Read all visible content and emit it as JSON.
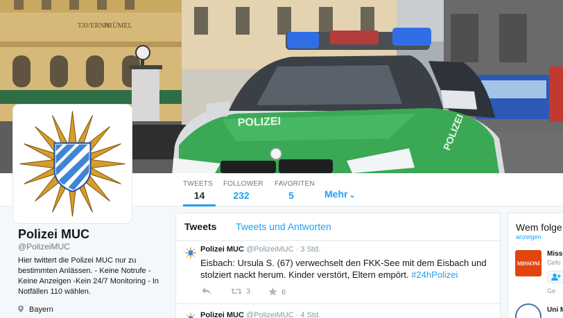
{
  "header": {
    "building_sign_1": "TAVERNA",
    "building_sign_2": "PRÜMEL",
    "car_label": "POLIZEI",
    "car_label_2": "POLIZEI",
    "plate": "",
    "colors": {
      "car_green": "#3aa854",
      "car_silver": "#d9dde0",
      "lightbar_blue": "#2f6ee6"
    }
  },
  "nav": {
    "tweets": {
      "label": "TWEETS",
      "value": "14"
    },
    "follower": {
      "label": "FOLLOWER",
      "value": "232"
    },
    "favoriten": {
      "label": "FAVORITEN",
      "value": "5"
    },
    "more": {
      "label": "Mehr",
      "icon": "chevron-down-icon"
    }
  },
  "profile": {
    "name": "Polizei MUC",
    "handle": "@PolizeiMUC",
    "bio": "Hier twittert die Polizei MUC nur zu bestimmten Anlässen. - Keine Notrufe - Keine Anzeigen -Kein 24/7 Monitoring - In Notfällen 110 wählen.",
    "location": "Bayern",
    "avatar_icon": "police-star-badge-icon"
  },
  "timeline": {
    "tabs": [
      {
        "label": "Tweets",
        "active": true
      },
      {
        "label": "Tweets und Antworten",
        "active": false
      }
    ],
    "tweets": [
      {
        "name": "Polizei MUC",
        "handle": "@PolizeiMUC",
        "sep": " · ",
        "time": "3 Std.",
        "text": "Eisbach: Ursula S. (67) verwechselt den FKK-See mit dem Eisbach und stolziert nackt herum. Kinder verstört, Eltern empört. ",
        "hashtag": "#24hPolizei",
        "retweets": "3",
        "favorites": "6"
      },
      {
        "name": "Polizei MUC",
        "handle": "@PolizeiMUC",
        "sep": " · ",
        "time": "4 Std."
      }
    ]
  },
  "who_to_follow": {
    "title": "Wem folge",
    "link": "anzeigen",
    "items": [
      {
        "logo_text": "MISSONI",
        "name": "Misso",
        "sub": "Gefo",
        "sub2": "Ge"
      },
      {
        "name": "Uni M"
      }
    ],
    "colors": {
      "missoni_bg": "#e2440e"
    }
  }
}
